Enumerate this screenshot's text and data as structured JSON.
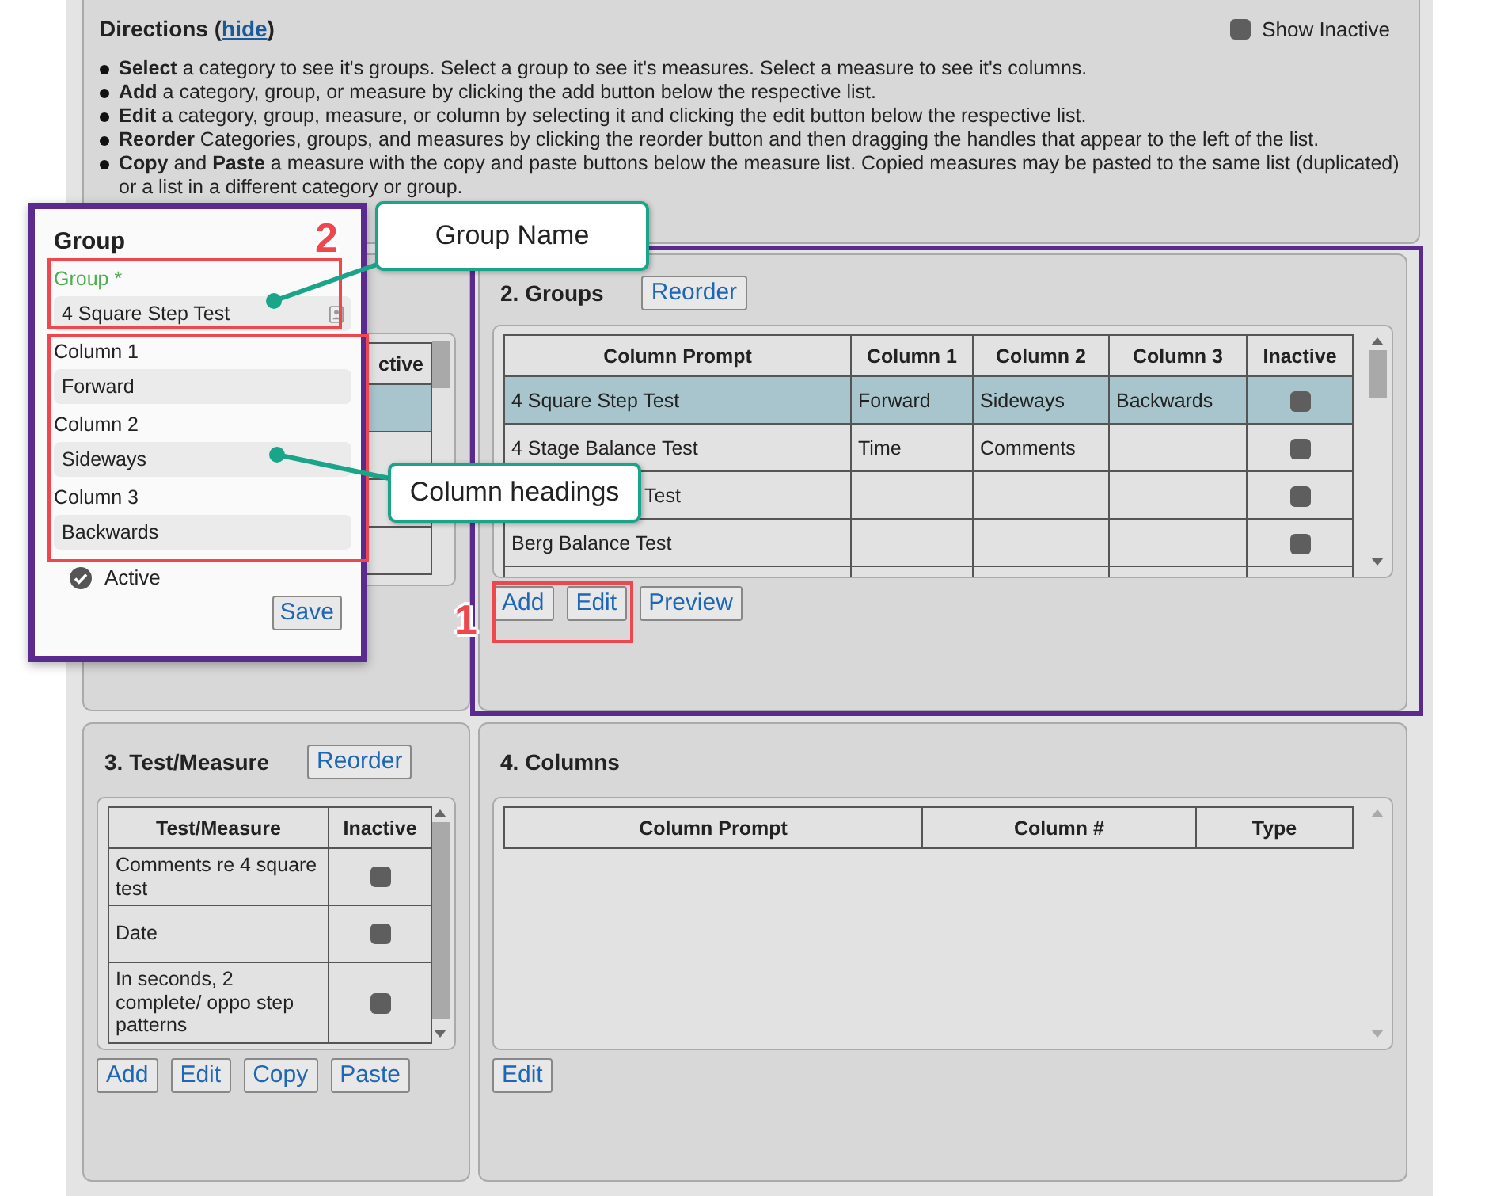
{
  "directions": {
    "title": "Directions (",
    "hide_link": "hide",
    "title_end": ")",
    "show_inactive": {
      "label": "Show Inactive",
      "checked": false
    },
    "items": [
      "**Select** a category to see it's groups. Select a group to see it's measures. Select a measure to see it's columns.",
      "**Add** a category, group, or measure by clicking the add button below the respective list.",
      "**Edit** a category, group, measure, or column by selecting it and clicking the edit button below the respective list.",
      "**Reorder** Categories, groups, and measures by clicking the reorder button and then dragging the handles that appear to the left of the list.",
      "**Copy** and **Paste** a measure with the copy and paste buttons below the measure list. Copied measures may be pasted to the same list (duplicated) or a list in a different category or group."
    ]
  },
  "categories": {
    "table": {
      "columns": [
        "ctive"
      ],
      "rows": [
        {
          "selected": true
        },
        {
          "selected": false
        },
        {
          "selected": false
        },
        {
          "selected": false
        }
      ]
    }
  },
  "groups": {
    "title": "2. Groups",
    "reorder": "Reorder",
    "table": {
      "columns": [
        "Column Prompt",
        "Column 1",
        "Column 2",
        "Column 3",
        "Inactive"
      ],
      "rows": [
        {
          "cells": [
            "4 Square Step Test",
            "Forward",
            "Sideways",
            "Backwards"
          ],
          "inactive": false,
          "selected": true
        },
        {
          "cells": [
            "4 Stage Balance Test",
            "Time",
            "Comments",
            null
          ],
          "inactive": false,
          "selected": false
        },
        {
          "cells": [
            "Test",
            null,
            null,
            null
          ],
          "inactive": false,
          "selected": false
        },
        {
          "cells": [
            "Berg Balance Test",
            null,
            null,
            null
          ],
          "inactive": false,
          "selected": false
        }
      ]
    },
    "buttons": [
      "Add",
      "Edit",
      "Preview"
    ]
  },
  "measures": {
    "title": "3. Test/Measure",
    "reorder": "Reorder",
    "table": {
      "columns": [
        "Test/Measure",
        "Inactive"
      ],
      "rows": [
        {
          "cells": [
            "Comments re 4 square test"
          ],
          "inactive": false,
          "selected": false
        },
        {
          "cells": [
            "Date"
          ],
          "inactive": false,
          "selected": false
        },
        {
          "cells": [
            "In seconds, 2 complete/ oppo step patterns"
          ],
          "inactive": false,
          "selected": false
        }
      ]
    },
    "buttons": [
      "Add",
      "Edit",
      "Copy",
      "Paste"
    ]
  },
  "columns": {
    "title": "4. Columns",
    "table": {
      "columns": [
        "Column Prompt",
        "Column #",
        "Type"
      ]
    },
    "buttons": [
      "Edit"
    ]
  },
  "group_dialog": {
    "title": "Group",
    "name_field": {
      "label": "Group *",
      "value": "4 Square Step Test"
    },
    "fields": [
      {
        "label": "Column 1",
        "value": "Forward"
      },
      {
        "label": "Column 2",
        "value": "Sideways"
      },
      {
        "label": "Column 3",
        "value": "Backwards"
      }
    ],
    "active": {
      "label": "Active",
      "checked": true
    },
    "save": "Save"
  },
  "annotations": {
    "callouts": [
      "Group Name",
      "Column headings"
    ],
    "step_numbers": [
      "2",
      "1"
    ]
  }
}
